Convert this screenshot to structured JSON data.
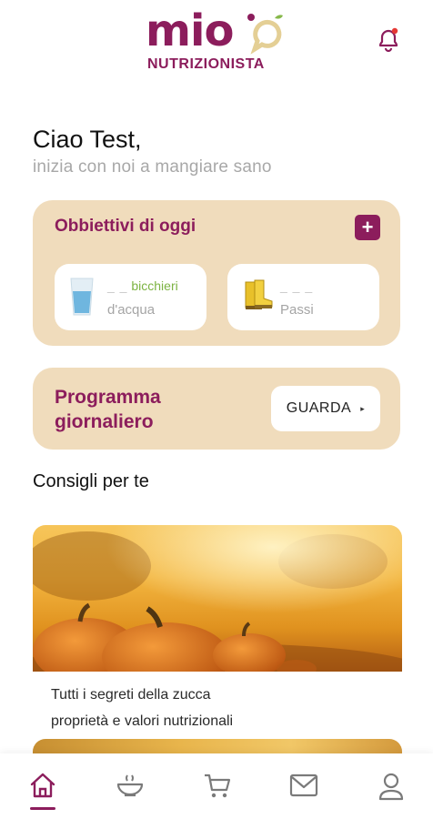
{
  "header": {
    "logo_word": "mio",
    "logo_sub": "NUTRIZIONISTA",
    "notification_icon": "bell-icon"
  },
  "greeting": {
    "title": "Ciao Test,",
    "subtitle": "inizia con noi a mangiare sano"
  },
  "goals": {
    "title": "Obbiettivi di oggi",
    "add_label": "+",
    "water": {
      "value": "_ _",
      "unit": "bicchieri",
      "label": "d'acqua",
      "icon": "water-glass-icon"
    },
    "steps": {
      "value": "_ _ _",
      "label": "Passi",
      "icon": "boots-icon"
    }
  },
  "program": {
    "title": "Programma giornaliero",
    "button_label": "GUARDA",
    "button_arrow": "▸"
  },
  "advice": {
    "section_title": "Consigli per te",
    "articles": [
      {
        "line1": "Tutti i segreti della zucca",
        "line2": "proprietà e valori nutrizionali",
        "image": "pumpkins-photo"
      }
    ]
  },
  "bottom_nav": {
    "items": [
      {
        "icon": "home-icon",
        "active": true
      },
      {
        "icon": "bowl-icon",
        "active": false
      },
      {
        "icon": "cart-icon",
        "active": false
      },
      {
        "icon": "mail-icon",
        "active": false
      },
      {
        "icon": "profile-icon",
        "active": false
      }
    ]
  },
  "colors": {
    "brand": "#8c1d5c",
    "card_bg": "#f0dcbc",
    "accent_green": "#7cb342"
  }
}
